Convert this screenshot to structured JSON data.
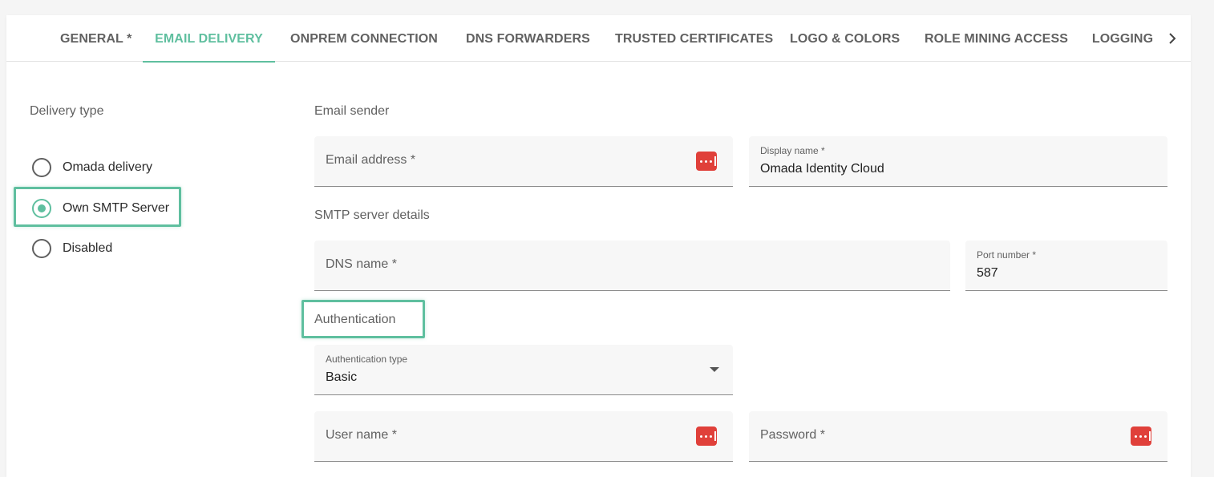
{
  "tabs": [
    {
      "label": "GENERAL *",
      "active": false
    },
    {
      "label": "EMAIL DELIVERY",
      "active": true
    },
    {
      "label": "ONPREM CONNECTION",
      "active": false
    },
    {
      "label": "DNS FORWARDERS",
      "active": false
    },
    {
      "label": "TRUSTED CERTIFICATES",
      "active": false
    },
    {
      "label": "LOGO & COLORS",
      "active": false
    },
    {
      "label": "ROLE MINING ACCESS",
      "active": false
    },
    {
      "label": "LOGGING",
      "active": false
    }
  ],
  "delivery": {
    "title": "Delivery type",
    "options": [
      {
        "label": "Omada delivery",
        "checked": false
      },
      {
        "label": "Own SMTP Server",
        "checked": true
      },
      {
        "label": "Disabled",
        "checked": false
      }
    ]
  },
  "email_sender": {
    "title": "Email sender",
    "email_address": {
      "label": "Email address *",
      "value": ""
    },
    "display_name": {
      "label": "Display name *",
      "value": "Omada Identity Cloud"
    }
  },
  "smtp": {
    "title": "SMTP server details",
    "dns_name": {
      "label": "DNS name *",
      "value": ""
    },
    "port_number": {
      "label": "Port number *",
      "value": "587"
    }
  },
  "authentication": {
    "title": "Authentication",
    "type": {
      "label": "Authentication type",
      "value": "Basic"
    },
    "user_name": {
      "label": "User name *",
      "value": ""
    },
    "password": {
      "label": "Password *",
      "value": ""
    }
  },
  "colors": {
    "accent": "#5fbf9f",
    "password_manager_icon": "#e0403a"
  },
  "icons": {
    "tab_scroll": "chevron-right-icon",
    "password_manager": "password-manager-icon",
    "dropdown": "caret-down-icon"
  }
}
